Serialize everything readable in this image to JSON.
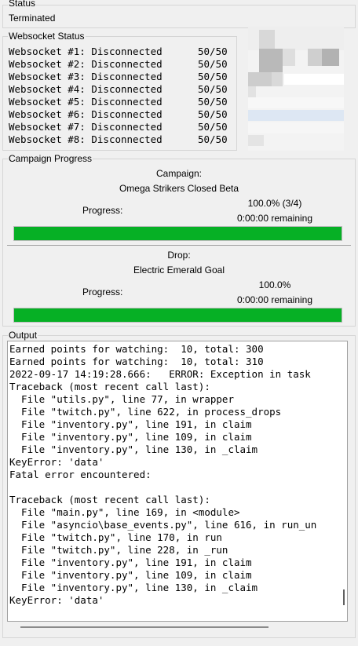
{
  "status": {
    "legend": "Status",
    "value": "Terminated"
  },
  "websocket": {
    "legend": "Websocket Status",
    "rows": [
      {
        "label": "Websocket #1:",
        "state": "Disconnected",
        "count": "50/50"
      },
      {
        "label": "Websocket #2:",
        "state": "Disconnected",
        "count": "50/50"
      },
      {
        "label": "Websocket #3:",
        "state": "Disconnected",
        "count": "50/50"
      },
      {
        "label": "Websocket #4:",
        "state": "Disconnected",
        "count": "50/50"
      },
      {
        "label": "Websocket #5:",
        "state": "Disconnected",
        "count": "50/50"
      },
      {
        "label": "Websocket #6:",
        "state": "Disconnected",
        "count": "50/50"
      },
      {
        "label": "Websocket #7:",
        "state": "Disconnected",
        "count": "50/50"
      },
      {
        "label": "Websocket #8:",
        "state": "Disconnected",
        "count": "50/50"
      }
    ]
  },
  "campaign": {
    "legend": "Campaign Progress",
    "campaign_label": "Campaign:",
    "campaign_name": "Omega Strikers Closed Beta",
    "progress_label": "Progress:",
    "campaign_percent": "100.0% (3/4)",
    "campaign_remaining": "0:00:00 remaining",
    "campaign_fraction": 1.0,
    "drop_label": "Drop:",
    "drop_name": "Electric Emerald Goal",
    "drop_percent": "100.0%",
    "drop_remaining": "0:00:00 remaining",
    "drop_fraction": 1.0,
    "bar_color": "#06b025"
  },
  "output": {
    "legend": "Output",
    "lines": [
      "Earned points for watching:  10, total: 300",
      "Earned points for watching:  10, total: 310",
      "2022-09-17 14:19:28.666:   ERROR: Exception in task",
      "Traceback (most recent call last):",
      "  File \"utils.py\", line 77, in wrapper",
      "  File \"twitch.py\", line 622, in process_drops",
      "  File \"inventory.py\", line 191, in claim",
      "  File \"inventory.py\", line 109, in claim",
      "  File \"inventory.py\", line 130, in _claim",
      "KeyError: 'data'",
      "Fatal error encountered:",
      "",
      "Traceback (most recent call last):",
      "  File \"main.py\", line 169, in <module>",
      "  File \"asyncio\\base_events.py\", line 616, in run_un",
      "  File \"twitch.py\", line 170, in run",
      "  File \"twitch.py\", line 228, in _run",
      "  File \"inventory.py\", line 191, in claim",
      "  File \"inventory.py\", line 109, in claim",
      "  File \"inventory.py\", line 130, in _claim",
      "KeyError: 'data'"
    ]
  }
}
